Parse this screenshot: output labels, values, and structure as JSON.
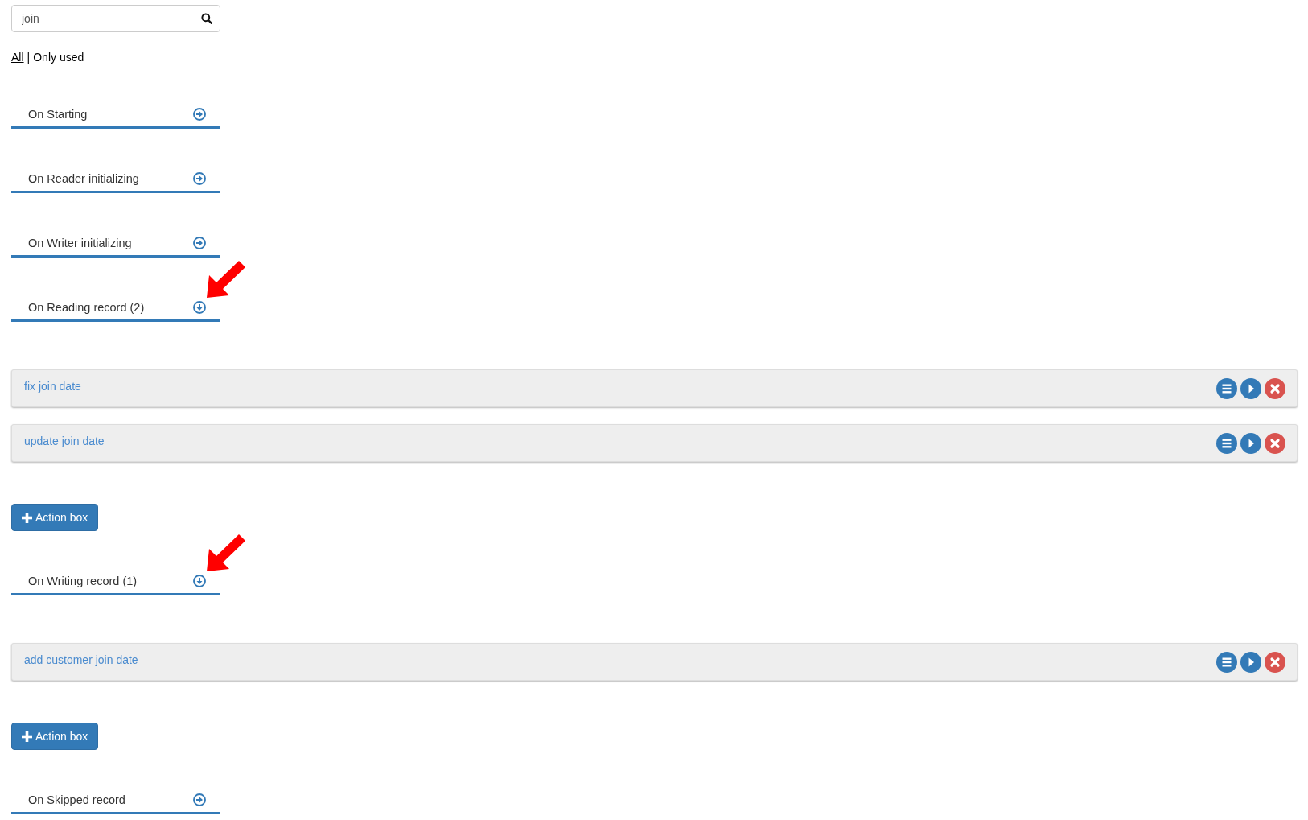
{
  "search": {
    "value": "join"
  },
  "filters": {
    "options": [
      {
        "label": "All",
        "selected": true
      },
      {
        "label": "Only used",
        "selected": false
      }
    ],
    "separator": "|"
  },
  "sections": [
    {
      "title": "On Starting",
      "expanded": false,
      "annotated": false
    },
    {
      "title": "On Reader initializing",
      "expanded": false,
      "annotated": false
    },
    {
      "title": "On Writer initializing",
      "expanded": false,
      "annotated": false
    },
    {
      "title": "On Reading record (2)",
      "expanded": true,
      "annotated": true,
      "actions": [
        "fix join date",
        "update join date"
      ],
      "add_button": "Action box"
    },
    {
      "title": "On Writing record (1)",
      "expanded": true,
      "annotated": true,
      "actions": [
        "add customer join date"
      ],
      "add_button": "Action box"
    },
    {
      "title": "On Skipped record",
      "expanded": false,
      "annotated": false
    }
  ]
}
